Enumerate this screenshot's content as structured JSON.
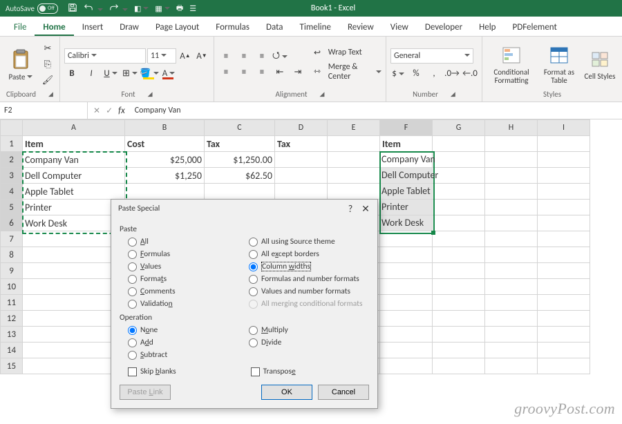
{
  "titlebar": {
    "autosave": "AutoSave",
    "autosave_state": "Off",
    "title": "Book1 - Excel"
  },
  "tabs": {
    "file": "File",
    "home": "Home",
    "insert": "Insert",
    "draw": "Draw",
    "page_layout": "Page Layout",
    "formulas": "Formulas",
    "data": "Data",
    "timeline": "Timeline",
    "review": "Review",
    "view": "View",
    "developer": "Developer",
    "help": "Help",
    "pdf": "PDFelement"
  },
  "ribbon": {
    "clipboard": {
      "paste": "Paste",
      "label": "Clipboard"
    },
    "font": {
      "name": "Calibri",
      "size": "11",
      "label": "Font",
      "bold": "B",
      "italic": "I",
      "underline": "U"
    },
    "alignment": {
      "wrap": "Wrap Text",
      "merge": "Merge & Center",
      "label": "Alignment"
    },
    "number": {
      "format": "General",
      "currency": "$",
      "percent": "%",
      "comma": ",",
      "label": "Number"
    },
    "styles": {
      "cond": "Conditional Formatting",
      "table": "Format as Table",
      "cell": "Cell Styles",
      "label": "Styles"
    }
  },
  "fbar": {
    "cell": "F2",
    "content": "Company Van"
  },
  "grid": {
    "cols": [
      "A",
      "B",
      "C",
      "D",
      "E",
      "F",
      "G",
      "H",
      "I"
    ],
    "rows": [
      "1",
      "2",
      "3",
      "4",
      "5",
      "6",
      "7",
      "8",
      "9",
      "10",
      "11",
      "12",
      "13",
      "14",
      "15"
    ],
    "headers": {
      "A": "Item",
      "B": "Cost",
      "C": "Tax",
      "D": "Tax",
      "F": "Item"
    },
    "A": [
      "Company Van",
      "Dell Computer",
      "Apple Tablet",
      "Printer",
      "Work Desk"
    ],
    "B": [
      "$25,000",
      "$1,250"
    ],
    "C": [
      "$1,250.00",
      "$62.50"
    ],
    "F": [
      "Company Van",
      "Dell Computer",
      "Apple Tablet",
      "Printer",
      "Work Desk"
    ]
  },
  "dialog": {
    "title": "Paste Special",
    "paste_label": "Paste",
    "operation_label": "Operation",
    "radios_left": {
      "all": "All",
      "formulas": "Formulas",
      "values": "Values",
      "formats": "Formats",
      "comments": "Comments",
      "validation": "Validation"
    },
    "radios_right": {
      "theme": "All using Source theme",
      "borders": "All except borders",
      "widths": "Column widths",
      "formnum": "Formulas and number formats",
      "valnum": "Values and number formats",
      "merge": "All merging conditional formats"
    },
    "op_left": {
      "none": "None",
      "add": "Add",
      "subtract": "Subtract"
    },
    "op_right": {
      "multiply": "Multiply",
      "divide": "Divide"
    },
    "skip_blanks": "Skip blanks",
    "transpose": "Transpose",
    "paste_link": "Paste Link",
    "ok": "OK",
    "cancel": "Cancel"
  },
  "watermark": "groovyPost.com"
}
